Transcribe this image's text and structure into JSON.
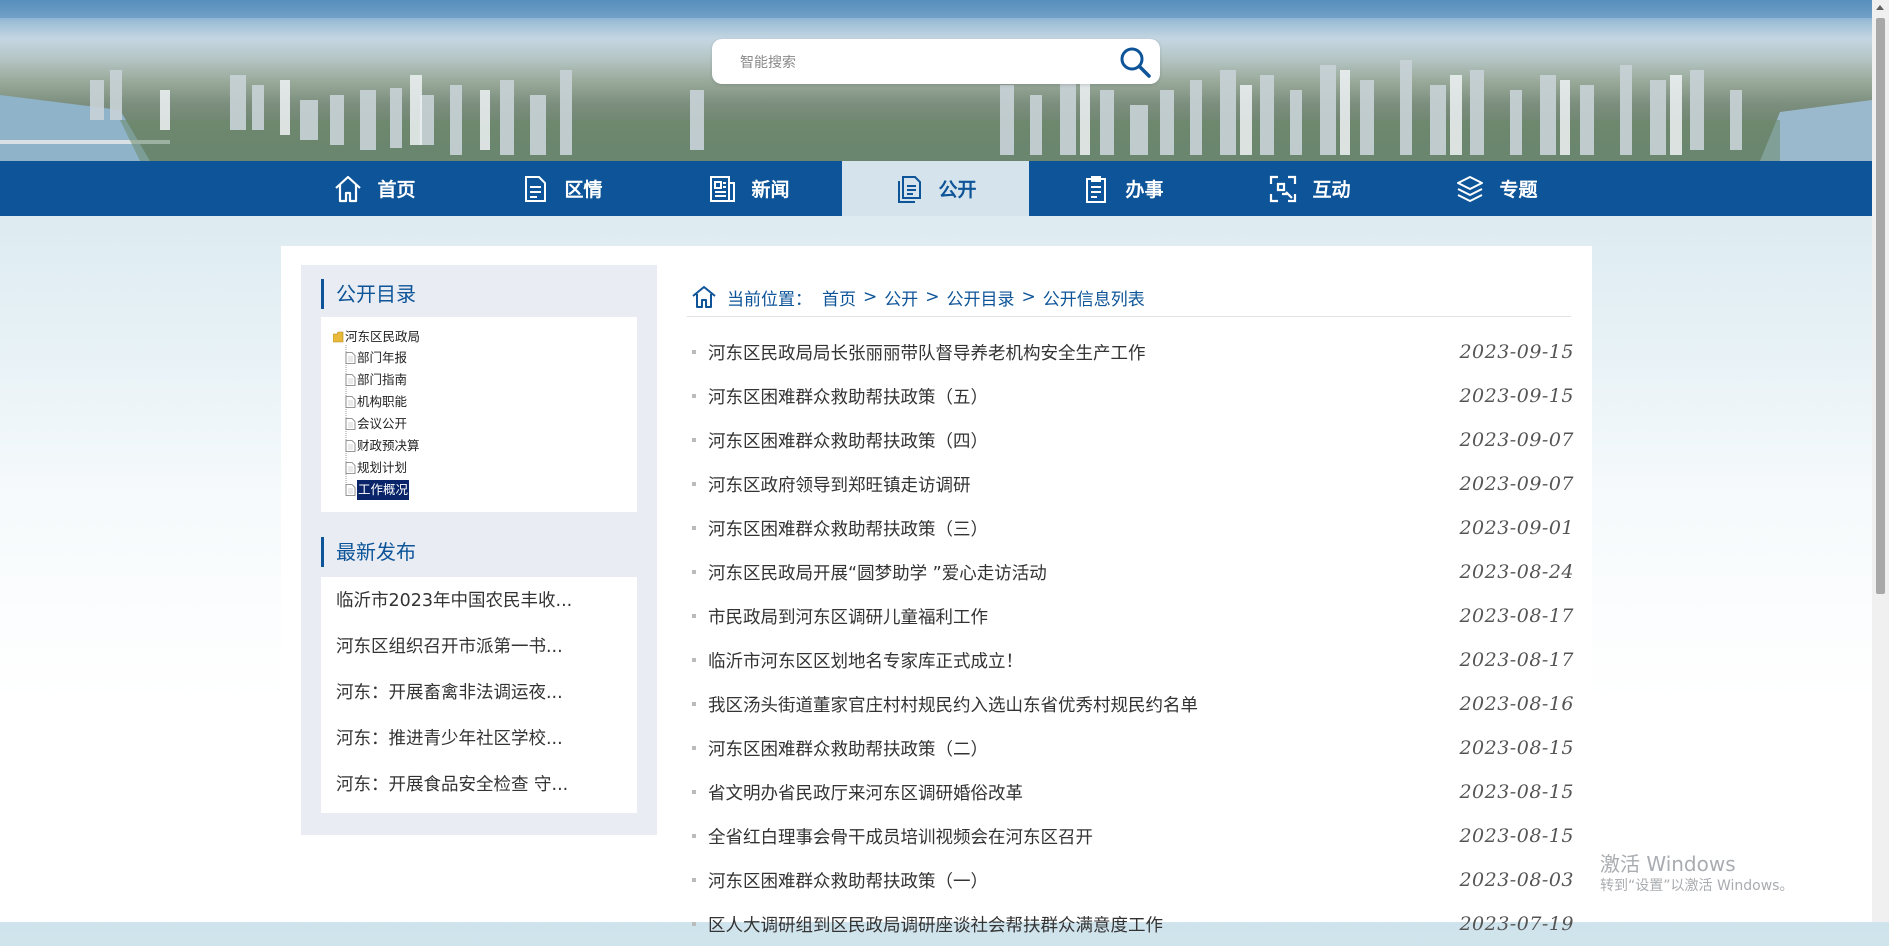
{
  "search": {
    "placeholder": "智能搜索"
  },
  "nav": {
    "items": [
      {
        "label": "首页"
      },
      {
        "label": "区情"
      },
      {
        "label": "新闻"
      },
      {
        "label": "公开"
      },
      {
        "label": "办事"
      },
      {
        "label": "互动"
      },
      {
        "label": "专题"
      }
    ]
  },
  "sidebar": {
    "catalog_title": "公开目录",
    "tree": {
      "root": "河东区民政局",
      "items": [
        "部门年报",
        "部门指南",
        "机构职能",
        "会议公开",
        "财政预决算",
        "规划计划",
        "工作概况"
      ]
    },
    "latest_title": "最新发布",
    "latest": [
      "临沂市2023年中国农民丰收...",
      "河东区组织召开市派第一书...",
      "河东：开展畜禽非法调运夜...",
      "河东：推进青少年社区学校...",
      "河东：开展食品安全检查 守..."
    ]
  },
  "breadcrumb": {
    "label": "当前位置：",
    "items": [
      "首页",
      "公开",
      "公开目录",
      "公开信息列表"
    ]
  },
  "list": [
    {
      "title": "河东区民政局局长张丽丽带队督导养老机构安全生产工作",
      "date": "2023-09-15"
    },
    {
      "title": "河东区困难群众救助帮扶政策（五）",
      "date": "2023-09-15"
    },
    {
      "title": "河东区困难群众救助帮扶政策（四）",
      "date": "2023-09-07"
    },
    {
      "title": "河东区政府领导到郑旺镇走访调研",
      "date": "2023-09-07"
    },
    {
      "title": "河东区困难群众救助帮扶政策（三）",
      "date": "2023-09-01"
    },
    {
      "title": "河东区民政局开展“圆梦助学 ”爱心走访活动",
      "date": "2023-08-24"
    },
    {
      "title": "市民政局到河东区调研儿童福利工作",
      "date": "2023-08-17"
    },
    {
      "title": "临沂市河东区区划地名专家库正式成立！",
      "date": "2023-08-17"
    },
    {
      "title": "我区汤头街道董家官庄村村规民约入选山东省优秀村规民约名单",
      "date": "2023-08-16"
    },
    {
      "title": "河东区困难群众救助帮扶政策（二）",
      "date": "2023-08-15"
    },
    {
      "title": "省文明办省民政厅来河东区调研婚俗改革",
      "date": "2023-08-15"
    },
    {
      "title": "全省红白理事会骨干成员培训视频会在河东区召开",
      "date": "2023-08-15"
    },
    {
      "title": "河东区困难群众救助帮扶政策（一）",
      "date": "2023-08-03"
    },
    {
      "title": "区人大调研组到区民政局调研座谈社会帮扶群众满意度工作",
      "date": "2023-07-19"
    }
  ],
  "watermark": {
    "line1": "激活 Windows",
    "line2": "转到“设置”以激活 Windows。"
  }
}
